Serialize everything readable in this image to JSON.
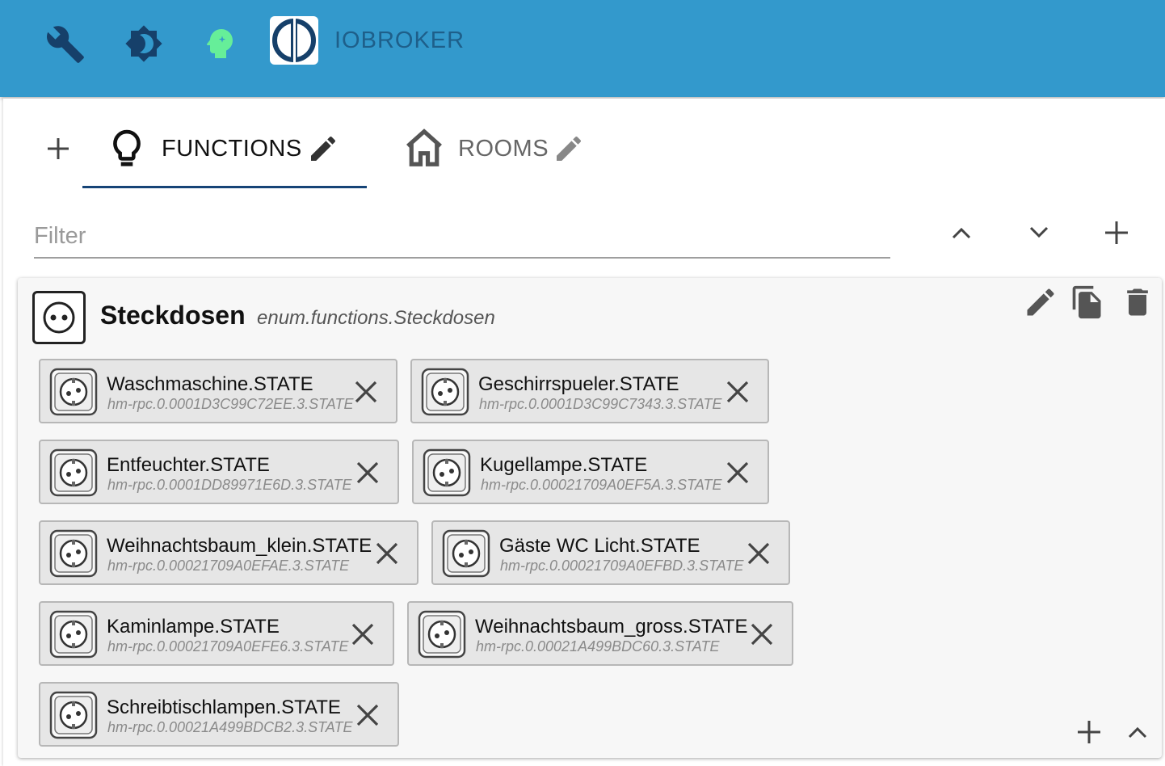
{
  "header": {
    "app_name": "IOBROKER",
    "icons": [
      "wrench-icon",
      "theme-icon",
      "expert-mode-icon",
      "iobroker-logo"
    ]
  },
  "tabs": [
    {
      "label": "FUNCTIONS",
      "icon": "lightbulb-icon",
      "active": true
    },
    {
      "label": "ROOMS",
      "icon": "home-icon",
      "active": false
    }
  ],
  "filter": {
    "placeholder": "Filter",
    "value": ""
  },
  "group": {
    "title": "Steckdosen",
    "id": "enum.functions.Steckdosen",
    "icon": "socket-icon"
  },
  "members": [
    {
      "name": "Waschmaschine.STATE",
      "id": "hm-rpc.0.0001D3C99C72EE.3.STATE"
    },
    {
      "name": "Geschirrspueler.STATE",
      "id": "hm-rpc.0.0001D3C99C7343.3.STATE"
    },
    {
      "name": "Entfeuchter.STATE",
      "id": "hm-rpc.0.0001DD89971E6D.3.STATE"
    },
    {
      "name": "Kugellampe.STATE",
      "id": "hm-rpc.0.00021709A0EF5A.3.STATE"
    },
    {
      "name": "Weihnachtsbaum_klein.STATE",
      "id": "hm-rpc.0.00021709A0EFAE.3.STATE"
    },
    {
      "name": "Gäste WC Licht.STATE",
      "id": "hm-rpc.0.00021709A0EFBD.3.STATE"
    },
    {
      "name": "Kaminlampe.STATE",
      "id": "hm-rpc.0.00021709A0EFE6.3.STATE"
    },
    {
      "name": "Weihnachtsbaum_gross.STATE",
      "id": "hm-rpc.0.00021A499BDC60.3.STATE"
    },
    {
      "name": "Schreibtischlampen.STATE",
      "id": "hm-rpc.0.00021A499BDCB2.3.STATE"
    }
  ],
  "colors": {
    "appbar": "#3399cc",
    "active_tab_indicator": "#164477",
    "expert_icon": "#66ee99",
    "chip_background": "#e6e6e6"
  }
}
